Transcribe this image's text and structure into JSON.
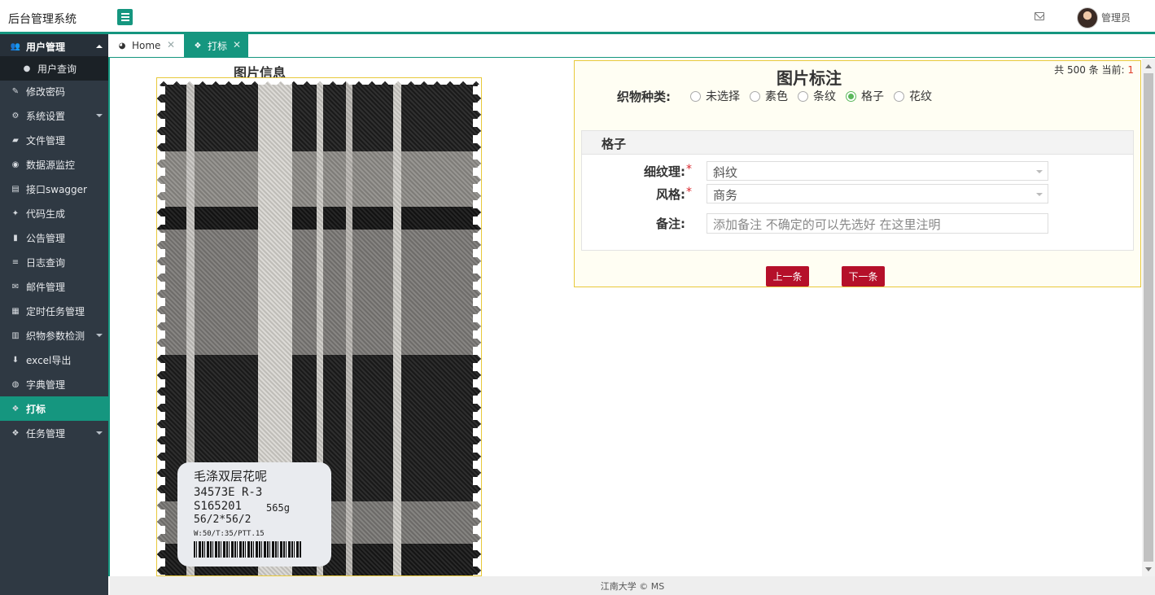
{
  "app": {
    "title": "后台管理系统",
    "user_name": "管理员"
  },
  "sidebar": {
    "items": [
      {
        "label": "用户管理"
      },
      {
        "label": "用户查询"
      },
      {
        "label": "修改密码"
      },
      {
        "label": "系统设置"
      },
      {
        "label": "文件管理"
      },
      {
        "label": "数据源监控"
      },
      {
        "label": "接口swagger"
      },
      {
        "label": "代码生成"
      },
      {
        "label": "公告管理"
      },
      {
        "label": "日志查询"
      },
      {
        "label": "邮件管理"
      },
      {
        "label": "定时任务管理"
      },
      {
        "label": "织物参数检测"
      },
      {
        "label": "excel导出"
      },
      {
        "label": "字典管理"
      },
      {
        "label": "打标"
      },
      {
        "label": "任务管理"
      }
    ]
  },
  "tabs": [
    {
      "label": "Home"
    },
    {
      "label": "打标"
    }
  ],
  "image_panel": {
    "title": "图片信息",
    "fabric_label": {
      "line1": "毛涤双层花呢",
      "line2": "34573E R-3",
      "line3a": "S165201",
      "line3b": "565g",
      "line4": "56/2*56/2",
      "line5": "W:50/T:35/PTT.15"
    }
  },
  "annotation": {
    "title": "图片标注",
    "counter_prefix": "共 500 条 当前:",
    "counter_current": "1",
    "type_label": "织物种类:",
    "type_options": [
      "未选择",
      "素色",
      "条纹",
      "格子",
      "花纹"
    ],
    "type_selected": "格子",
    "section_title": "格子",
    "texture_label": "细纹理:",
    "texture_value": "斜纹",
    "style_label": "风格:",
    "style_value": "商务",
    "note_label": "备注:",
    "note_placeholder": "添加备注 不确定的可以先选好 在这里注明",
    "prev_label": "上一条",
    "next_label": "下一条"
  },
  "footer": {
    "text": "江南大学 © MS"
  },
  "colors": {
    "accent": "#15967f",
    "sidebar_bg": "#2f3943",
    "button": "#b5102a",
    "panel_border": "#e8c93a"
  }
}
